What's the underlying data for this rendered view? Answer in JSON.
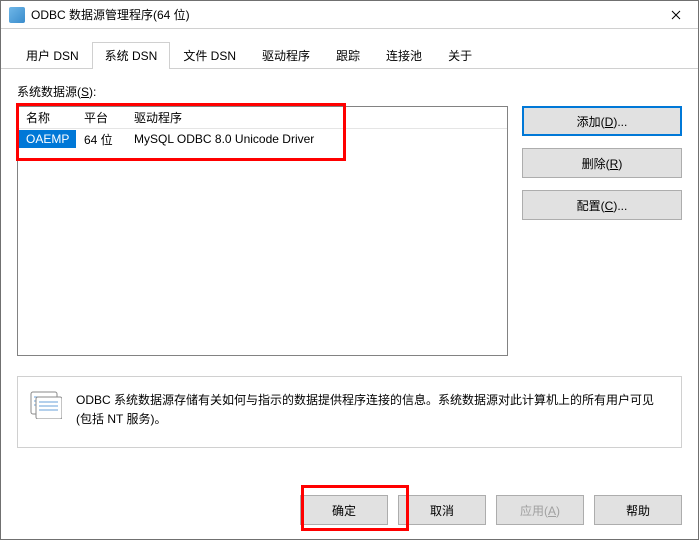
{
  "window": {
    "title": "ODBC 数据源管理程序(64 位)"
  },
  "tabs": {
    "user_dsn": "用户 DSN",
    "system_dsn": "系统 DSN",
    "file_dsn": "文件 DSN",
    "drivers": "驱动程序",
    "trace": "跟踪",
    "pool": "连接池",
    "about": "关于"
  },
  "label": {
    "sys_sources_prefix": "系统数据源(",
    "sys_sources_key": "S",
    "sys_sources_suffix": "):"
  },
  "table": {
    "headers": {
      "name": "名称",
      "platform": "平台",
      "driver": "驱动程序"
    },
    "rows": [
      {
        "name": "OAEMP",
        "platform": "64 位",
        "driver": "MySQL ODBC 8.0 Unicode Driver"
      }
    ]
  },
  "buttons": {
    "add_prefix": "添加(",
    "add_key": "D",
    "add_suffix": ")...",
    "remove_prefix": "删除(",
    "remove_key": "R",
    "remove_suffix": ")",
    "config_prefix": "配置(",
    "config_key": "C",
    "config_suffix": ")...",
    "ok": "确定",
    "cancel": "取消",
    "apply_prefix": "应用(",
    "apply_key": "A",
    "apply_suffix": ")",
    "help": "帮助"
  },
  "info": {
    "text": "ODBC 系统数据源存储有关如何与指示的数据提供程序连接的信息。系统数据源对此计算机上的所有用户可见(包括 NT 服务)。"
  }
}
